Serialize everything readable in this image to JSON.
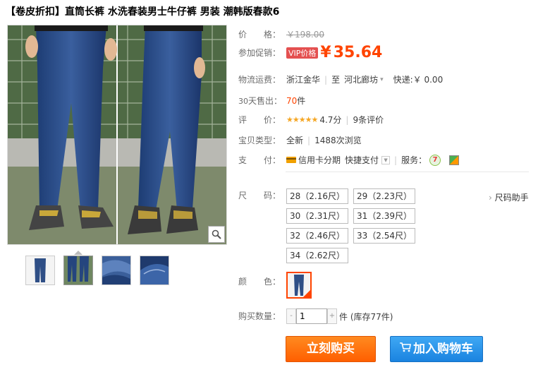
{
  "product": {
    "title": "【卷皮折扣】直筒长裤 水洗春装男士牛仔裤 男装 潮韩版春款6"
  },
  "price": {
    "label": "价　　格：",
    "original": "￥198.00",
    "promo_label": "参加促销：",
    "vip_badge": "VIP价格",
    "yen": "¥",
    "current": "35.64"
  },
  "shipping": {
    "label": "物流运费：",
    "from": "浙江金华",
    "to_prefix": "至",
    "to": "河北廊坊",
    "express": "快递:￥ 0.00"
  },
  "sales": {
    "label_num": "30",
    "label_text": "天售出：",
    "count": "70",
    "unit": "件"
  },
  "rating": {
    "label": "评　　价：",
    "stars": "★★★★★",
    "score": "4.7分",
    "reviews": "9条评价"
  },
  "item_type": {
    "label": "宝贝类型：",
    "condition": "全新",
    "views": "1488次浏览"
  },
  "payment": {
    "label": "支　　付：",
    "credit": "信用卡分期",
    "quick": "快捷支付",
    "service_label": "服务：",
    "service_badge": "7"
  },
  "size": {
    "label": "尺　　码：",
    "helper": "尺码助手",
    "options": [
      "28（2.16尺）",
      "29（2.23尺）",
      "30（2.31尺）",
      "31（2.39尺）",
      "32（2.46尺）",
      "33（2.54尺）",
      "34（2.62尺）"
    ]
  },
  "color": {
    "label": "颜　　色："
  },
  "quantity": {
    "label": "购买数量：",
    "minus": "-",
    "value": "1",
    "plus": "+",
    "unit_stock": "件 (库存77件)"
  },
  "actions": {
    "buy": "立刻购买",
    "cart": "加入购物车"
  },
  "colors": {
    "accent": "#ff4400",
    "buy_button": "#ff6d00",
    "cart_button": "#1a83e0",
    "vip_badge": "#e45050"
  }
}
